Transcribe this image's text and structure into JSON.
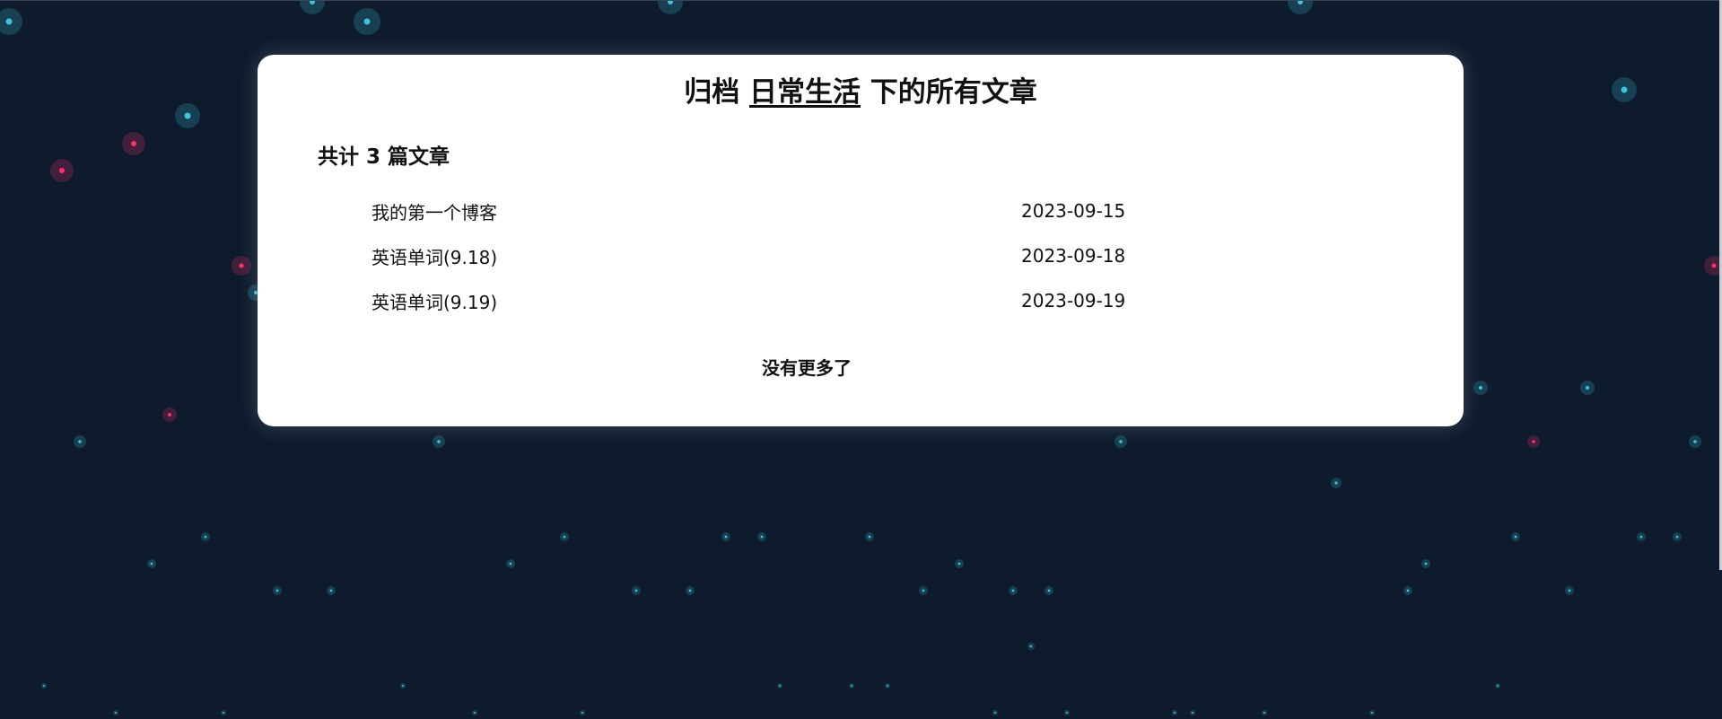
{
  "header": {
    "prefix": "归档",
    "category": "日常生活",
    "suffix": "下的所有文章"
  },
  "summary": {
    "count_text": "共计 3 篇文章"
  },
  "posts": [
    {
      "title": "我的第一个博客",
      "date": "2023-09-15"
    },
    {
      "title": "英语单词(9.18)",
      "date": "2023-09-18"
    },
    {
      "title": "英语单词(9.19)",
      "date": "2023-09-19"
    }
  ],
  "footer": {
    "no_more": "没有更多了"
  },
  "theme": {
    "background": "#0e1b2c",
    "particle_cyan": "#3cc4dc",
    "particle_pink": "#ff2f6d",
    "card": "#ffffff"
  }
}
